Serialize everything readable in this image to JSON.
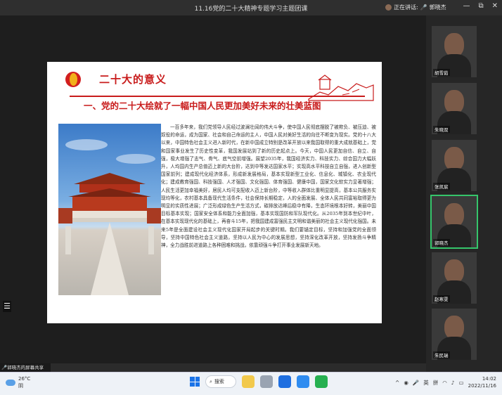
{
  "window": {
    "title": "11.16党的二十大精神专题学习主题团课",
    "speaking_label": "正在讲话:",
    "speaking_name": "郭晓杰"
  },
  "slide": {
    "header_title": "二十大的意义",
    "section_title": "一、党的二十大绘就了一幅中国人民更加美好未来的壮美蓝图",
    "body": "一百多年来，我们党领导人民经过波澜壮阔的伟大斗争，使中国人民彻底摆脱了被欺负、被压迫、被奴役的命运，成为国家、社会和自己命运的主人，中国人民对美好生活的向往不断变为现实。党的十八大以来，中国特色社会主义进入新时代，在新中国成立特别是改革开放以来我国取得的重大成就基础上，党和国家事业发生了历史性变革，我国发展站到了新的历史起点上。今天，中国人民更加自信、自立、自强，极大增强了志气、骨气、底气空前增强。展望2035年，我国经济实力、科技实力、综合国力大幅跃升，人均国内生产总值迈上新的大台阶，达到中等发达国家水平；实现高水平科技自立自强，进入创新型国家前列；建成现代化经济体系，形成新发展格局，基本实现新型工业化、信息化、城镇化、农业现代化；建成教育强国、科技强国、人才强国、文化强国、体育强国、健康中国，国家文化软实力显著增强；人民生活更加幸福美好，居民人均可支配收入迈上新台阶，中等收入群体比重明显提高，基本公共服务实现均等化，农村基本具备现代生活条件，社会保持长期稳定，人的全面发展、全体人民共同富裕取得更为明显的实质性进展；广泛形成绿色生产生活方式，碳排放达峰后稳中有降，生态环境根本好转，美丽中国目标基本实现；国家安全体系和能力全面加强，基本实现国防和军队现代化。从2035年到本世纪中叶，在基本实现现代化的基础上，再奋斗15年，把我国建成富强民主文明和谐美丽的社会主义现代化强国。未来5年是全面建设社会主义现代化国家开局起步的关键时期。我们要锚定目标，坚持和加强党的全面领导，坚持中国特色社会主义道路，坚持以人民为中心的发展思想，坚持深化改革开放，坚持发扬斗争精神，全力战胜前进道路上各种困难和挑战，依靠顽强斗争打开事业发展新天地。"
  },
  "share_label": "郭晓杰的屏幕共享",
  "participants": [
    {
      "name": "胡雪茹",
      "active": false
    },
    {
      "name": "朱晓双",
      "active": false
    },
    {
      "name": "张凯宸",
      "active": false
    },
    {
      "name": "郭晓杰",
      "active": true
    },
    {
      "name": "赵寒雯",
      "active": false
    },
    {
      "name": "朱民瑞",
      "active": false
    }
  ],
  "taskbar": {
    "temperature": "26°C",
    "weather": "阴",
    "search": "搜索",
    "lang": "英",
    "ime": "拼",
    "time": "14:02",
    "date": "2022/11/16"
  },
  "colors": {
    "accent_red": "#c81b1b",
    "active_green": "#35c56b"
  }
}
